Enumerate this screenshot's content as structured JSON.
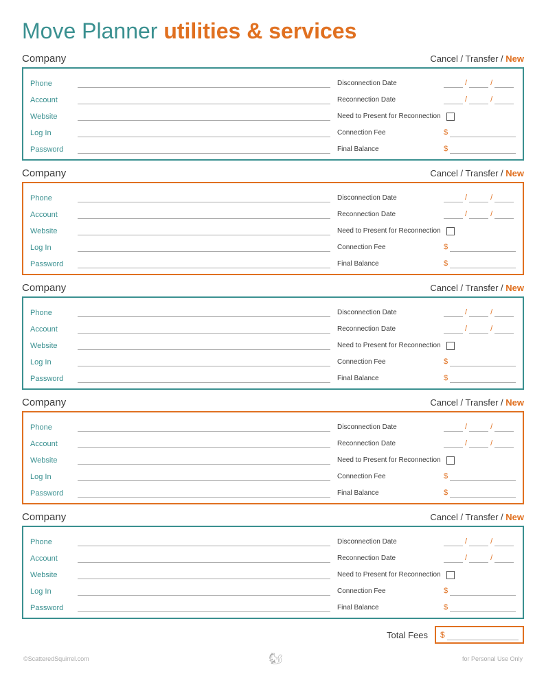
{
  "page": {
    "title_main": "Move Planner ",
    "title_sub": "utilities & services"
  },
  "footer": {
    "left": "©ScatteredSquirrel.com",
    "center": "🐿",
    "right": "for Personal Use Only"
  },
  "labels": {
    "company": "Company",
    "cancel": "Cancel",
    "transfer": "Transfer",
    "new": "New",
    "phone": "Phone",
    "account": "Account",
    "website": "Website",
    "login": "Log In",
    "password": "Password",
    "disconnection_date": "Disconnection Date",
    "reconnection_date": "Reconnection Date",
    "need_to_present": "Need to Present for Reconnection",
    "connection_fee": "Connection Fee",
    "final_balance": "Final Balance",
    "total_fees": "Total Fees"
  },
  "sections": [
    {
      "border": "teal"
    },
    {
      "border": "orange"
    },
    {
      "border": "teal"
    },
    {
      "border": "orange"
    },
    {
      "border": "teal"
    }
  ]
}
